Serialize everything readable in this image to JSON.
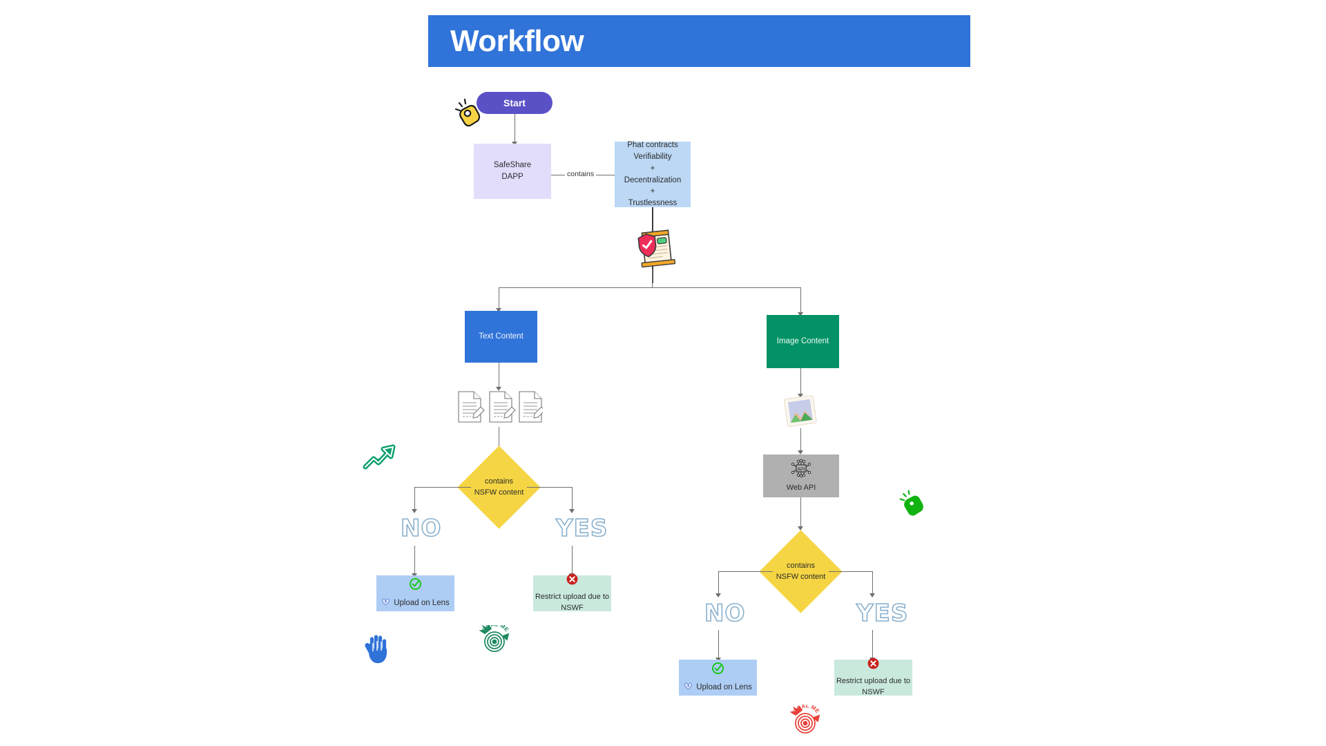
{
  "header": {
    "title": "Workflow",
    "bar_color": "#3174d9"
  },
  "diagram": {
    "nodes": {
      "start": {
        "label": "Start",
        "color": "#5b51c7"
      },
      "safeshare": {
        "line1": "SafeShare",
        "line2": "DAPP",
        "color": "#e2ddfb"
      },
      "phat": {
        "line1": "Phat contracts",
        "line2": "Verifiability",
        "line3": "+",
        "line4": "Decentralization",
        "line5": "+",
        "line6": "Trustlessness",
        "color": "#bcd8f5"
      },
      "text_content": {
        "label": "Text Content",
        "color": "#3174d9"
      },
      "image_content": {
        "label": "Image Content",
        "color": "#039267"
      },
      "web_api": {
        "label": "Web API",
        "icon_label": "API",
        "color": "#b0b0b0"
      },
      "decision_text": {
        "line1": "contains",
        "line2": "NSFW content",
        "color": "#f5d543"
      },
      "decision_image": {
        "line1": "contains",
        "line2": "NSFW content",
        "color": "#f5d543"
      },
      "upload_text": {
        "label": "Upload on Lens",
        "color": "#aecdf4"
      },
      "restrict_text": {
        "line1": "Restrict upload due to",
        "line2": "NSWF",
        "color": "#c9e9dd"
      },
      "upload_image": {
        "label": "Upload on Lens",
        "color": "#aecdf4"
      },
      "restrict_image": {
        "line1": "Restrict upload due to",
        "line2": "NSWF",
        "color": "#c9e9dd"
      }
    },
    "edges": {
      "contains_label": "contains"
    },
    "branch_labels": {
      "text_no": "NO",
      "text_yes": "YES",
      "image_no": "NO",
      "image_yes": "YES"
    },
    "stickers": {
      "ok_hand_yellow": "ok-hand-sticker-yellow",
      "ok_hand_green": "ok-hand-sticker-green",
      "arrow_up_green": "trending-arrow-sticker-green",
      "clap_hand_blue": "raised-hand-sticker-blue",
      "goal_met_green": {
        "text": "GOAL MET",
        "color": "#1e8a5f"
      },
      "goal_met_red": {
        "text": "GOAL MET",
        "color": "#e8413a"
      },
      "verified_document": "verified-document-icon",
      "text_docs": "document-pencil-icon",
      "photo": "photo-image-icon"
    }
  }
}
